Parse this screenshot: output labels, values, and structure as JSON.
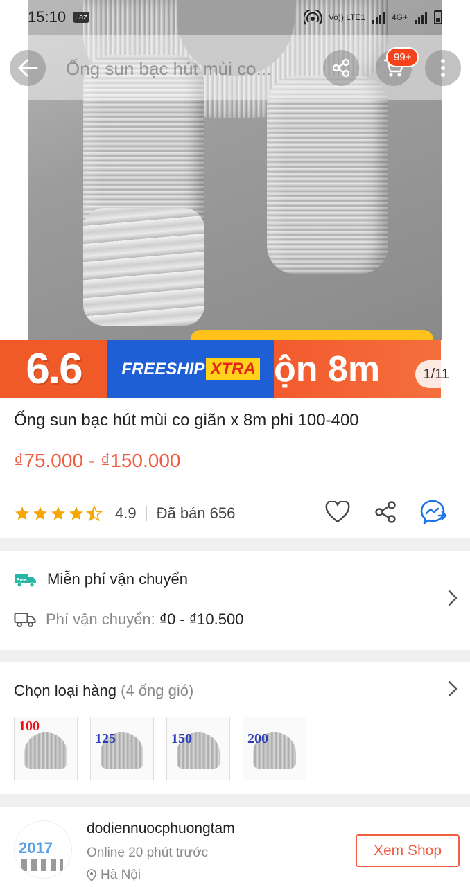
{
  "status_bar": {
    "time": "15:10",
    "app_badge": "Laz",
    "net1": "Vo)) LTE1",
    "net2": "4G+"
  },
  "header": {
    "search_text": "Ống sun bạc hút mùi co...",
    "cart_badge": "99+"
  },
  "gallery": {
    "banner_66": "6.6",
    "banner_freeship": "FREESHIP",
    "banner_xtra": "XTRA",
    "banner_overlay": "ộn 8m",
    "counter": "1/11"
  },
  "product": {
    "title": "Ống sun bạc hút mùi co giãn x 8m phi 100-400",
    "price": "₫75.000 - ₫150.000",
    "rating": "4.9",
    "rating_stars": 4.5,
    "sold": "Đã bán 656"
  },
  "shipping": {
    "free_badge": "Free",
    "free_text": "Miễn phí vận chuyển",
    "fee_label": "Phí vận chuyển:",
    "fee_value": "₫0 - ₫10.500"
  },
  "variants": {
    "title": "Chọn loại hàng",
    "count": "(4 ống gió)",
    "items": [
      {
        "label": "100"
      },
      {
        "label": "125"
      },
      {
        "label": "150"
      },
      {
        "label": "200"
      }
    ]
  },
  "shop": {
    "name": "dodiennuocphuongtam",
    "online": "Online 20 phút trước",
    "location": "Hà Nội",
    "button": "Xem Shop"
  },
  "colors": {
    "accent": "#f05d40",
    "star": "#f6a700",
    "chat": "#1a73e8"
  }
}
